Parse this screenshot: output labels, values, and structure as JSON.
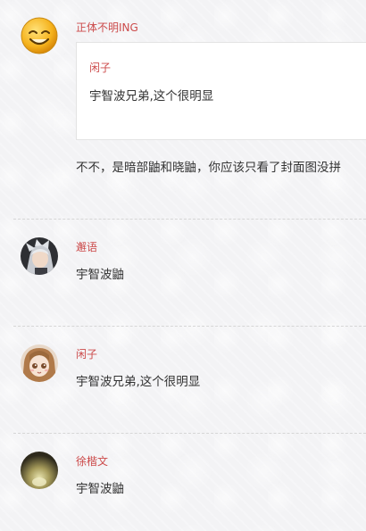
{
  "comments": [
    {
      "author": "正体不明ING",
      "quote_author": "闲子",
      "quote_text": "宇智波兄弟,这个很明显",
      "text": "不不，是暗部鼬和晓鼬，你应该只看了封面图没拼"
    },
    {
      "author": "邂语",
      "text": "宇智波鼬"
    },
    {
      "author": "闲子",
      "text": "宇智波兄弟,这个很明显"
    },
    {
      "author": "徐楷文",
      "text": "宇智波鼬"
    }
  ],
  "avatars": [
    "smiley-face-icon",
    "anime-character-avatar",
    "anime-girl-avatar",
    "blurred-photo-avatar"
  ]
}
